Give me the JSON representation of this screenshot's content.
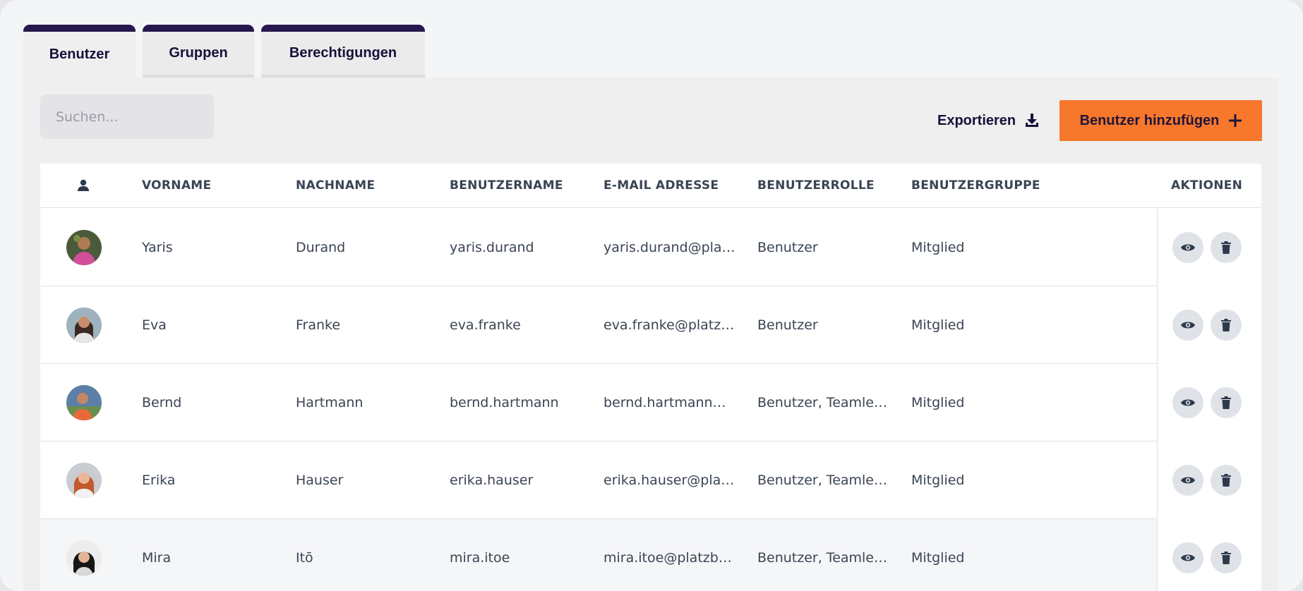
{
  "tabs": [
    {
      "label": "Benutzer",
      "active": true
    },
    {
      "label": "Gruppen",
      "active": false
    },
    {
      "label": "Berechtigungen",
      "active": false
    }
  ],
  "search": {
    "placeholder": "Suchen...",
    "icon": "search-icon"
  },
  "toolbar": {
    "export_label": "Exportieren",
    "add_label": "Benutzer hinzufügen",
    "accent_color": "#f7782c",
    "brand_color": "#27174f"
  },
  "table": {
    "columns": [
      "VORNAME",
      "NACHNAME",
      "BENUTZERNAME",
      "E-MAIL ADRESSE",
      "BENUTZERROLLE",
      "BENUTZERGRUPPE",
      "AKTIONEN"
    ],
    "rows": [
      {
        "first": "Yaris",
        "last": "Durand",
        "username": "yaris.durand",
        "email": "yaris.durand@pla…",
        "role": "Benutzer",
        "group": "Mitglied"
      },
      {
        "first": "Eva",
        "last": "Franke",
        "username": "eva.franke",
        "email": "eva.franke@platz…",
        "role": "Benutzer",
        "group": "Mitglied"
      },
      {
        "first": "Bernd",
        "last": "Hartmann",
        "username": "bernd.hartmann",
        "email": "bernd.hartmann…",
        "role": "Benutzer, Teamle…",
        "group": "Mitglied"
      },
      {
        "first": "Erika",
        "last": "Hauser",
        "username": "erika.hauser",
        "email": "erika.hauser@pla…",
        "role": "Benutzer, Teamle…",
        "group": "Mitglied"
      },
      {
        "first": "Mira",
        "last": "Itō",
        "username": "mira.itoe",
        "email": "mira.itoe@platzb…",
        "role": "Benutzer, Teamle…",
        "group": "Mitglied"
      }
    ]
  }
}
